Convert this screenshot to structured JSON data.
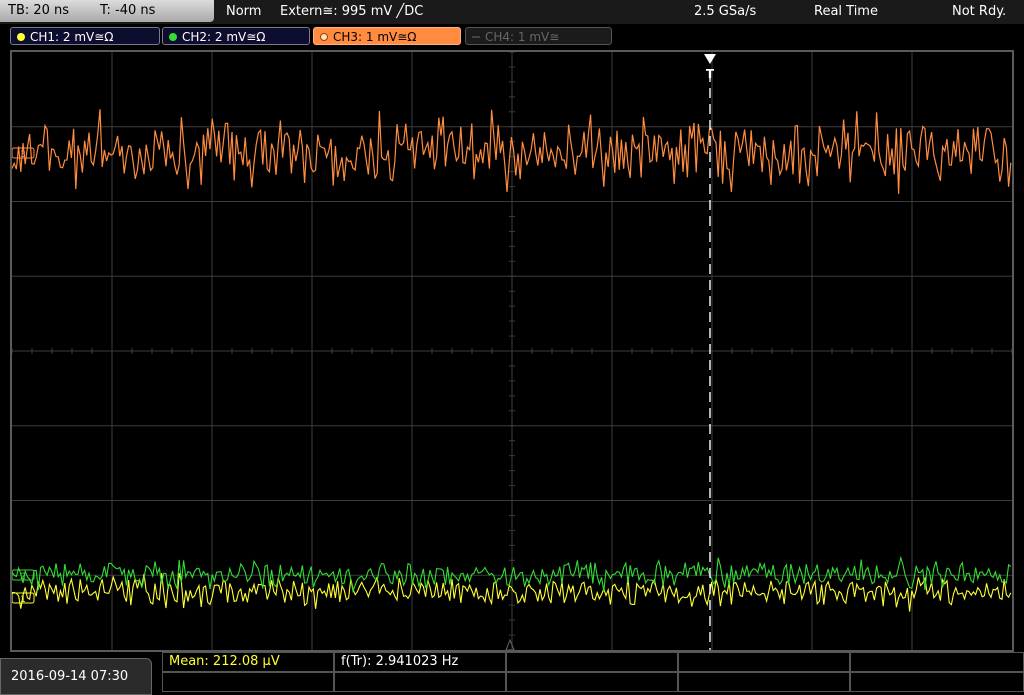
{
  "topbar": {
    "timebase": "TB: 20 ns",
    "trigger_pos": "T: -40 ns",
    "mode": "Norm",
    "trigger_source": "Extern≅: 995 mV ╱DC",
    "sample_rate": "2.5 GSa/s",
    "acq_mode": "Real Time",
    "status": "Not Rdy."
  },
  "channels": [
    {
      "label": "CH1: 2 mV≅Ω",
      "color": "#ffff33",
      "state": "on"
    },
    {
      "label": "CH2: 2 mV≅Ω",
      "color": "#33dd33",
      "state": "on"
    },
    {
      "label": "CH3: 1 mV≅Ω",
      "color": "#ff8c40",
      "state": "active"
    },
    {
      "label": "CH4: 1 mV≅",
      "color": "#666666",
      "state": "off"
    }
  ],
  "markers": {
    "ch3_marker": "3",
    "ch2_marker": "2",
    "ch1_marker": "1",
    "trigger": "T"
  },
  "bottom": {
    "datetime": "2016-09-14 07:30",
    "meas1": "Mean: 212.08 µV",
    "meas2": "f(Tr): 2.941023 Hz"
  },
  "colors": {
    "ch1": "#ffff33",
    "ch2": "#33dd33",
    "ch3": "#ff8c40",
    "grid": "#3c3c3c",
    "trigger": "#ffffff"
  }
}
